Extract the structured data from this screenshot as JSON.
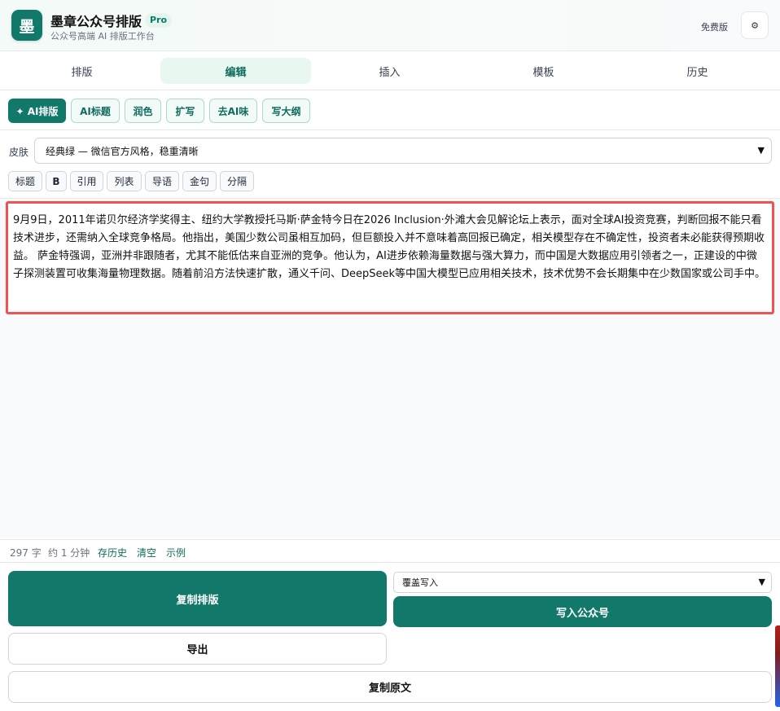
{
  "header": {
    "logo_char": "墨",
    "title": "墨章公众号排版",
    "badge": "Pro",
    "subtitle": "公众号高端 AI 排版工作台",
    "plan": "免费版",
    "settings_icon": "⚙"
  },
  "tabs": [
    {
      "label": "排版",
      "active": false
    },
    {
      "label": "编辑",
      "active": true
    },
    {
      "label": "插入",
      "active": false
    },
    {
      "label": "模板",
      "active": false
    },
    {
      "label": "历史",
      "active": false
    }
  ],
  "ai_tools": [
    {
      "label": "✦ AI排版"
    },
    {
      "label": "AI标题"
    },
    {
      "label": "润色"
    },
    {
      "label": "扩写"
    },
    {
      "label": "去AI味"
    },
    {
      "label": "写大纲"
    }
  ],
  "skin": {
    "label": "皮肤",
    "selected": "经典绿 — 微信官方风格，稳重清晰"
  },
  "format_tools": [
    {
      "label": "标题"
    },
    {
      "label": "B"
    },
    {
      "label": "引用"
    },
    {
      "label": "列表"
    },
    {
      "label": "导语"
    },
    {
      "label": "金句"
    },
    {
      "label": "分隔"
    }
  ],
  "editor": {
    "content": "9月9日，2011年诺贝尔经济学奖得主、纽约大学教授托马斯·萨金特今日在2026 Inclusion·外滩大会见解论坛上表示，面对全球AI投资竞赛，判断回报不能只看技术进步，还需纳入全球竞争格局。他指出，美国少数公司虽相互加码，但巨额投入并不意味着高回报已确定，相关模型存在不确定性，投资者未必能获得预期收益。 萨金特强调，亚洲并非跟随者，尤其不能低估来自亚洲的竞争。他认为，AI进步依赖海量数据与强大算力，而中国是大数据应用引领者之一，正建设的中微子探测装置可收集海量物理数据。随着前沿方法快速扩散，通义千问、DeepSeek等中国大模型已应用相关技术，技术优势不会长期集中在少数国家或公司手中。"
  },
  "stats": {
    "word_count": "297 字",
    "read_time": "约 1 分钟",
    "save_history": "存历史",
    "clear": "清空",
    "example": "示例"
  },
  "actions": {
    "copy_layout": "复制排版",
    "write_mode": "覆盖写入",
    "write_wechat": "写入公众号",
    "export": "导出",
    "copy_raw": "复制原文"
  }
}
